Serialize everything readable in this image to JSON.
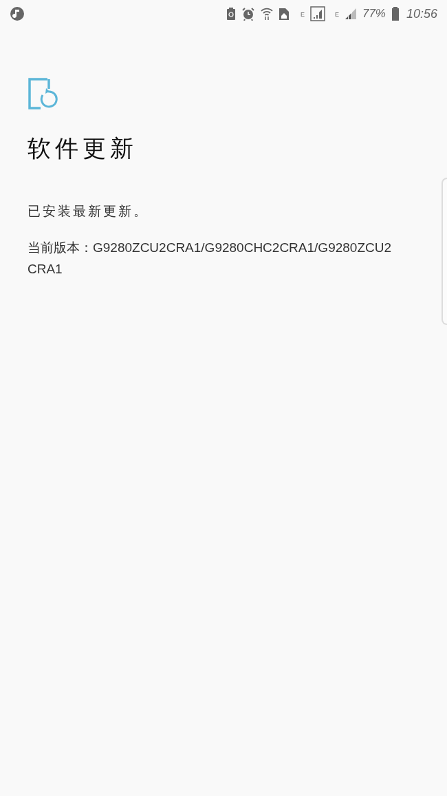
{
  "status_bar": {
    "network_1": "E",
    "network_2": "E",
    "battery": "77%",
    "time": "10:56"
  },
  "title": "软件更新",
  "message": "已安装最新更新。",
  "version": "当前版本：G9280ZCU2CRA1/G9280CHC2CRA1/G9280ZCU2CRA1"
}
